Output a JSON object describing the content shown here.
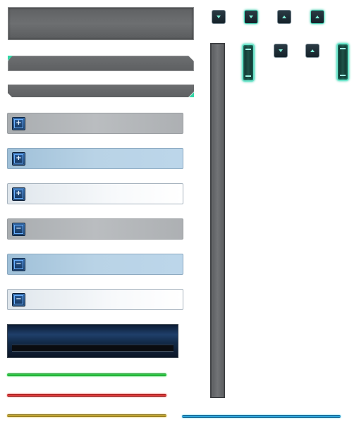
{
  "sprite_sheet": {
    "accordion": {
      "rows": [
        {
          "variant": "gray",
          "state": "collapsed",
          "glyph": "+",
          "icon": "plus-icon"
        },
        {
          "variant": "blue",
          "state": "collapsed",
          "glyph": "+",
          "icon": "plus-icon"
        },
        {
          "variant": "white",
          "state": "collapsed",
          "glyph": "+",
          "icon": "plus-icon"
        },
        {
          "variant": "gray",
          "state": "expanded",
          "glyph": "−",
          "icon": "minus-icon"
        },
        {
          "variant": "blue",
          "state": "expanded",
          "glyph": "−",
          "icon": "minus-icon"
        },
        {
          "variant": "white",
          "state": "expanded",
          "glyph": "−",
          "icon": "minus-icon"
        }
      ]
    },
    "status_lines": {
      "colors": {
        "green": "#3ce85a",
        "red": "#ff4a4a",
        "yellow": "#e0c040",
        "blue": "#3cc8ff"
      }
    },
    "arrow_buttons": {
      "icons": [
        "arrow-down-icon",
        "arrow-down-icon",
        "arrow-up-icon",
        "arrow-up-icon"
      ],
      "accent": "#4fe0c0"
    },
    "theme": {
      "panel_gray": "#6d6f71",
      "accent_teal": "#33d6a6",
      "header_blue": "#1f3f6a"
    }
  }
}
